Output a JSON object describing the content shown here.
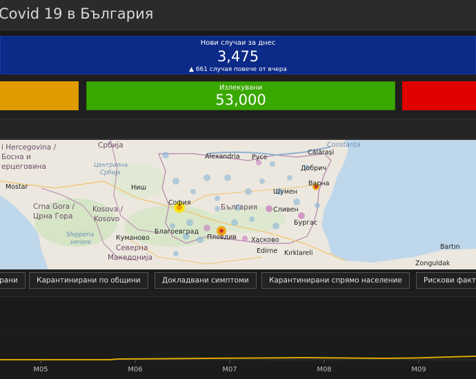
{
  "header": {
    "title": "Covid 19 в България"
  },
  "kpi_new": {
    "label": "Нови случаи за днес",
    "value": "3,475",
    "delta": "▲ 661 случая повече от вчера"
  },
  "kpi_recovered": {
    "label": "Излекувани",
    "value": "53,000"
  },
  "colors": {
    "new_cases_bg": "#0c2a87",
    "orange_panel": "#e09b00",
    "recovered_bg": "#39a800",
    "red_panel": "#e00000",
    "header_bg": "#2b2b2b",
    "chart_line": "#e0a800"
  },
  "map": {
    "labels": {
      "herzegovina": "i Hercegovina /",
      "bosna": "Босна и",
      "hercegovina": "ерцеговина",
      "srbija": "Србија",
      "centralna": "Централна",
      "srbija_region": "Србија",
      "alexandria": "Alexandria",
      "ruse": "Русе",
      "calarasi": "Călărași",
      "constanta": "Constanța",
      "varna": "Варна",
      "dobrich": "Добрич",
      "mostar": "Mostar",
      "nish": "Ниш",
      "sofia": "София",
      "shumen": "Шумен",
      "bulgaria": "България",
      "sliven": "Сливен",
      "burgas": "Бургас",
      "crna_gora": "Crna Gora /",
      "crna_gora_cyr": "Црна Гора",
      "kosova": "Kosova /",
      "kosovo": "Kosovo",
      "shqiperia": "Shqipëria",
      "veriore": "veriore",
      "blagoevgrad": "Благоевград",
      "plovdiv": "Пловдив",
      "haskovo": "Хасково",
      "kumanovo": "Куманово",
      "severna": "Северна",
      "makedonija": "Македонија",
      "edirne": "Edirne",
      "kirklareli": "Kırklareli",
      "bartin": "Bartın",
      "zonguldak": "Zonguldak"
    }
  },
  "tabs": [
    {
      "label": "рани"
    },
    {
      "label": "Карантинирани по общини"
    },
    {
      "label": "Докладвани симптоми"
    },
    {
      "label": "Карантинирани спрямо население"
    },
    {
      "label": "Рискови факт"
    }
  ],
  "chart_data": {
    "type": "area",
    "x_ticks": [
      "M05",
      "M06",
      "M07",
      "M08",
      "M09"
    ]
  }
}
